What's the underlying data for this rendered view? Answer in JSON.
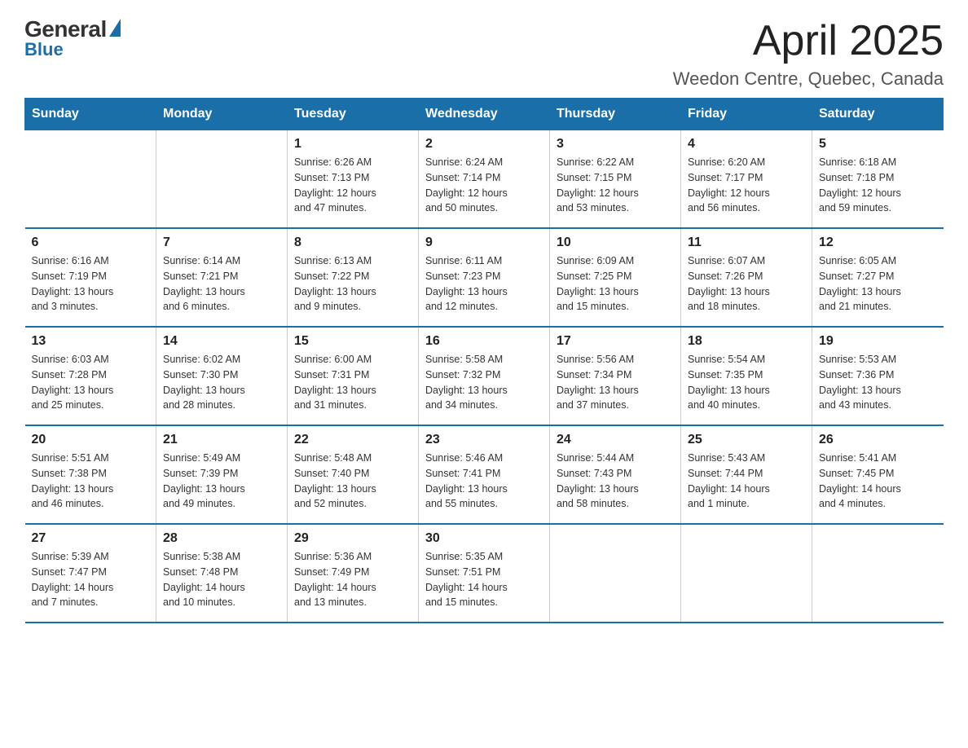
{
  "logo": {
    "general": "General",
    "blue": "Blue"
  },
  "header": {
    "title": "April 2025",
    "subtitle": "Weedon Centre, Quebec, Canada"
  },
  "weekdays": [
    "Sunday",
    "Monday",
    "Tuesday",
    "Wednesday",
    "Thursday",
    "Friday",
    "Saturday"
  ],
  "weeks": [
    [
      {
        "day": "",
        "info": ""
      },
      {
        "day": "",
        "info": ""
      },
      {
        "day": "1",
        "info": "Sunrise: 6:26 AM\nSunset: 7:13 PM\nDaylight: 12 hours\nand 47 minutes."
      },
      {
        "day": "2",
        "info": "Sunrise: 6:24 AM\nSunset: 7:14 PM\nDaylight: 12 hours\nand 50 minutes."
      },
      {
        "day": "3",
        "info": "Sunrise: 6:22 AM\nSunset: 7:15 PM\nDaylight: 12 hours\nand 53 minutes."
      },
      {
        "day": "4",
        "info": "Sunrise: 6:20 AM\nSunset: 7:17 PM\nDaylight: 12 hours\nand 56 minutes."
      },
      {
        "day": "5",
        "info": "Sunrise: 6:18 AM\nSunset: 7:18 PM\nDaylight: 12 hours\nand 59 minutes."
      }
    ],
    [
      {
        "day": "6",
        "info": "Sunrise: 6:16 AM\nSunset: 7:19 PM\nDaylight: 13 hours\nand 3 minutes."
      },
      {
        "day": "7",
        "info": "Sunrise: 6:14 AM\nSunset: 7:21 PM\nDaylight: 13 hours\nand 6 minutes."
      },
      {
        "day": "8",
        "info": "Sunrise: 6:13 AM\nSunset: 7:22 PM\nDaylight: 13 hours\nand 9 minutes."
      },
      {
        "day": "9",
        "info": "Sunrise: 6:11 AM\nSunset: 7:23 PM\nDaylight: 13 hours\nand 12 minutes."
      },
      {
        "day": "10",
        "info": "Sunrise: 6:09 AM\nSunset: 7:25 PM\nDaylight: 13 hours\nand 15 minutes."
      },
      {
        "day": "11",
        "info": "Sunrise: 6:07 AM\nSunset: 7:26 PM\nDaylight: 13 hours\nand 18 minutes."
      },
      {
        "day": "12",
        "info": "Sunrise: 6:05 AM\nSunset: 7:27 PM\nDaylight: 13 hours\nand 21 minutes."
      }
    ],
    [
      {
        "day": "13",
        "info": "Sunrise: 6:03 AM\nSunset: 7:28 PM\nDaylight: 13 hours\nand 25 minutes."
      },
      {
        "day": "14",
        "info": "Sunrise: 6:02 AM\nSunset: 7:30 PM\nDaylight: 13 hours\nand 28 minutes."
      },
      {
        "day": "15",
        "info": "Sunrise: 6:00 AM\nSunset: 7:31 PM\nDaylight: 13 hours\nand 31 minutes."
      },
      {
        "day": "16",
        "info": "Sunrise: 5:58 AM\nSunset: 7:32 PM\nDaylight: 13 hours\nand 34 minutes."
      },
      {
        "day": "17",
        "info": "Sunrise: 5:56 AM\nSunset: 7:34 PM\nDaylight: 13 hours\nand 37 minutes."
      },
      {
        "day": "18",
        "info": "Sunrise: 5:54 AM\nSunset: 7:35 PM\nDaylight: 13 hours\nand 40 minutes."
      },
      {
        "day": "19",
        "info": "Sunrise: 5:53 AM\nSunset: 7:36 PM\nDaylight: 13 hours\nand 43 minutes."
      }
    ],
    [
      {
        "day": "20",
        "info": "Sunrise: 5:51 AM\nSunset: 7:38 PM\nDaylight: 13 hours\nand 46 minutes."
      },
      {
        "day": "21",
        "info": "Sunrise: 5:49 AM\nSunset: 7:39 PM\nDaylight: 13 hours\nand 49 minutes."
      },
      {
        "day": "22",
        "info": "Sunrise: 5:48 AM\nSunset: 7:40 PM\nDaylight: 13 hours\nand 52 minutes."
      },
      {
        "day": "23",
        "info": "Sunrise: 5:46 AM\nSunset: 7:41 PM\nDaylight: 13 hours\nand 55 minutes."
      },
      {
        "day": "24",
        "info": "Sunrise: 5:44 AM\nSunset: 7:43 PM\nDaylight: 13 hours\nand 58 minutes."
      },
      {
        "day": "25",
        "info": "Sunrise: 5:43 AM\nSunset: 7:44 PM\nDaylight: 14 hours\nand 1 minute."
      },
      {
        "day": "26",
        "info": "Sunrise: 5:41 AM\nSunset: 7:45 PM\nDaylight: 14 hours\nand 4 minutes."
      }
    ],
    [
      {
        "day": "27",
        "info": "Sunrise: 5:39 AM\nSunset: 7:47 PM\nDaylight: 14 hours\nand 7 minutes."
      },
      {
        "day": "28",
        "info": "Sunrise: 5:38 AM\nSunset: 7:48 PM\nDaylight: 14 hours\nand 10 minutes."
      },
      {
        "day": "29",
        "info": "Sunrise: 5:36 AM\nSunset: 7:49 PM\nDaylight: 14 hours\nand 13 minutes."
      },
      {
        "day": "30",
        "info": "Sunrise: 5:35 AM\nSunset: 7:51 PM\nDaylight: 14 hours\nand 15 minutes."
      },
      {
        "day": "",
        "info": ""
      },
      {
        "day": "",
        "info": ""
      },
      {
        "day": "",
        "info": ""
      }
    ]
  ]
}
